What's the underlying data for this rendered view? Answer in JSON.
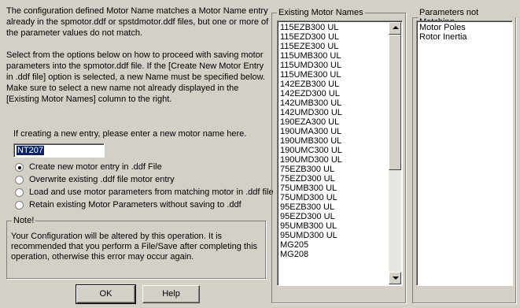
{
  "intro": {
    "paragraph1": "The configuration defined Motor Name matches a Motor Name entry already in the spmotor.ddf or spstdmotor.ddf files, but one or more of the parameter values do not match.",
    "paragraph2": "Select from the options below on how to proceed with saving motor parameters into the spmotor.ddf file. If the [Create New Motor Entry in .ddf file] option is selected, a new Name must be specified below. Make sure to select a new name not already displayed in the [Existing Motor Names] column to the right."
  },
  "new_entry": {
    "prompt": "If creating a new entry, please enter a new motor name here.",
    "value": "NT207"
  },
  "options": [
    {
      "label": "Create new motor entry in .ddf File",
      "checked": true
    },
    {
      "label": "Overwrite existing .ddf file motor entry",
      "checked": false
    },
    {
      "label": "Load and use motor parameters from matching motor in .ddf file",
      "checked": false
    },
    {
      "label": "Retain existing Motor Parameters without saving to .ddf",
      "checked": false
    }
  ],
  "note": {
    "title": "Note!",
    "text": "Your Configuration will be altered by this operation. It is recommended that you perform a File/Save after completing this operation, otherwise this error may occur again."
  },
  "buttons": {
    "ok": "OK",
    "help": "Help"
  },
  "existing_motor_names": {
    "title": "Existing Motor Names",
    "items": [
      "115EZB300 UL",
      "115EZD300 UL",
      "115EZE300 UL",
      "115UMB300 UL",
      "115UMD300 UL",
      "115UME300 UL",
      "142EZB300 UL",
      "142EZD300 UL",
      "142UMB300 UL",
      "142UMD300 UL",
      "190EZA300 UL",
      "190UMA300 UL",
      "190UMB300 UL",
      "190UMC300 UL",
      "190UMD300 UL",
      "75EZB300 UL",
      "75EZD300 UL",
      "75UMB300 UL",
      "75UMD300 UL",
      "95EZB300 UL",
      "95EZD300 UL",
      "95UMB300 UL",
      "95UMD300 UL",
      "MG205",
      "MG208"
    ]
  },
  "parameters_not_matching": {
    "title": "Parameters not Matching",
    "items": [
      "Motor Poles",
      "Rotor Inertia"
    ]
  },
  "colors": {
    "dialog_bg": "#d4d0c8",
    "selection": "#0a246a"
  }
}
